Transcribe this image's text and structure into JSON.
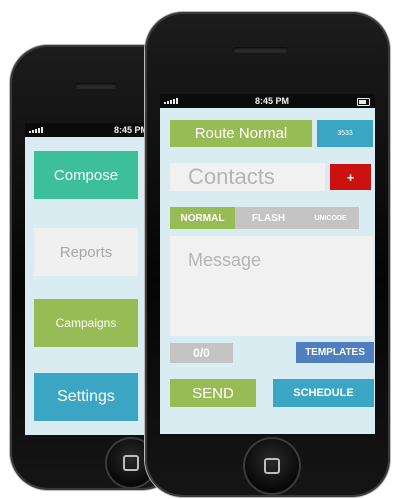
{
  "back_phone": {
    "status_time": "8:45 PM",
    "menu": [
      {
        "label": "Compose",
        "color": "#3dbf9a"
      },
      {
        "label": "Reports",
        "color": "#f0f0f0"
      },
      {
        "label": "Campaigns",
        "color": "#98bc55"
      },
      {
        "label": "Settings",
        "color": "#3aa6c4"
      }
    ]
  },
  "front_phone": {
    "status_time": "8:45 PM",
    "route_label": "Route Normal",
    "route_count": "3533",
    "contacts_placeholder": "Contacts",
    "add_contact_label": "+",
    "modes": [
      {
        "label": "NORMAL",
        "active": true
      },
      {
        "label": "FLASH",
        "active": false
      },
      {
        "label": "UNICODE",
        "active": false
      }
    ],
    "message_placeholder": "Message",
    "char_count": "0/0",
    "templates_label": "TEMPLATES",
    "send_label": "SEND",
    "schedule_label": "SCHEDULE"
  },
  "colors": {
    "screen_bg": "#d8ecf1",
    "green": "#98bc55",
    "teal": "#3dbf9a",
    "blue": "#3aa6c4",
    "steel_blue": "#4f7fbf",
    "red": "#cc1111",
    "grey": "#c4c4c4"
  }
}
